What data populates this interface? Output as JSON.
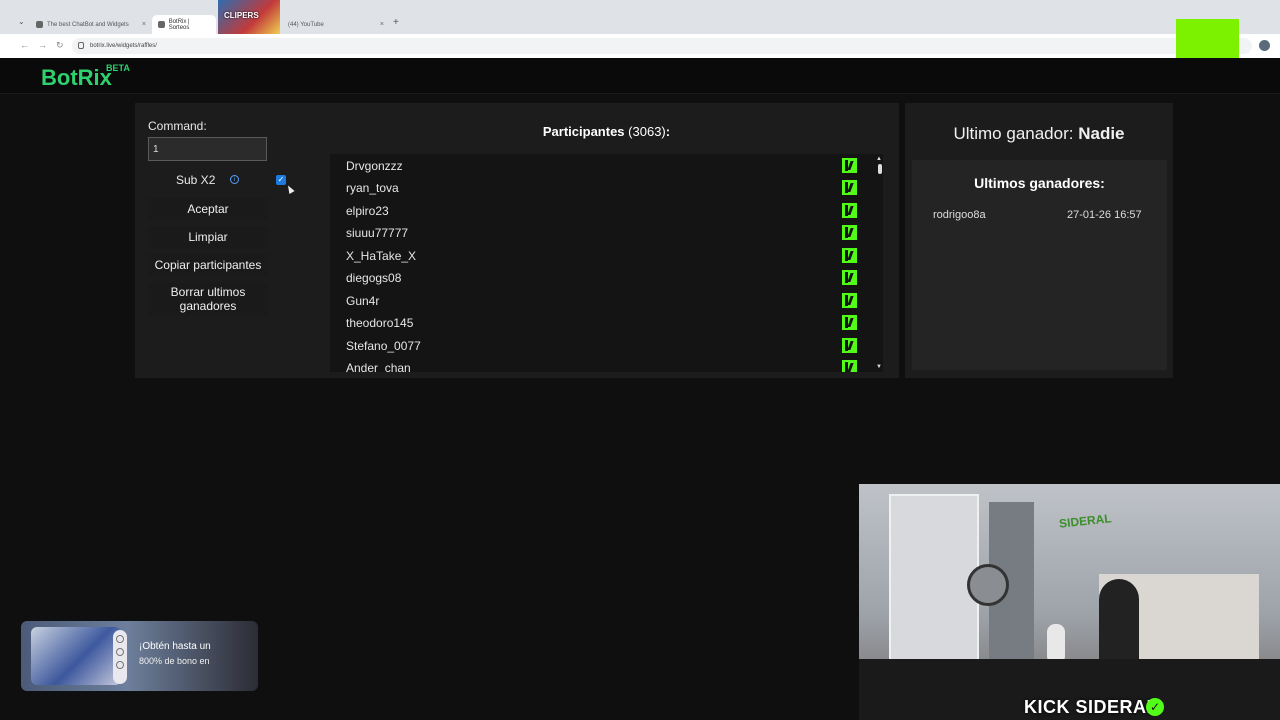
{
  "browser": {
    "tabs": [
      {
        "label": "The best ChatBot and Widgets",
        "active": false
      },
      {
        "label": "BotRix | Sorteos",
        "active": true
      },
      {
        "label": "(44) YouTube",
        "active": false
      }
    ],
    "thumbnail_text": "CLIPERS",
    "url": "botrix.live/widgets/raffles/"
  },
  "site": {
    "logo": "BotRix",
    "logo_badge": "BETA"
  },
  "raffle": {
    "command_label": "Command:",
    "command_value": "1",
    "subx2_label": "Sub X2",
    "subx2_checked": true,
    "buttons": {
      "accept": "Aceptar",
      "clear": "Limpiar",
      "copy": "Copiar participantes",
      "delete_winners": "Borrar ultimos ganadores"
    },
    "participants_label": "Participantes",
    "participants_count": "(3063)",
    "participants_suffix": ":",
    "participants": [
      "Drvgonzzz",
      "ryan_tova",
      "elpiro23",
      "siuuu77777",
      "X_HaTake_X",
      "diegogs08",
      "Gun4r",
      "theodoro145",
      "Stefano_0077",
      "Ander_chan"
    ]
  },
  "winners": {
    "last_winner_label": "Ultimo ganador:",
    "last_winner_value": "Nadie",
    "recent_title": "Ultimos ganadores:",
    "recent": [
      {
        "name": "rodrigoo8a",
        "date": "27-01-26 16:57"
      }
    ]
  },
  "ad": {
    "line1": "¡Obtén hasta un",
    "line2": "800% de bono en"
  },
  "stream": {
    "channel_platform": "KICK",
    "channel_name": "SIDERAL",
    "room_logo": "SIDERAL"
  },
  "colors": {
    "brand": "#2fd16e",
    "kick_green": "#53fc18",
    "overlay_square": "#7cf200",
    "checkbox": "#1f7ae0"
  }
}
